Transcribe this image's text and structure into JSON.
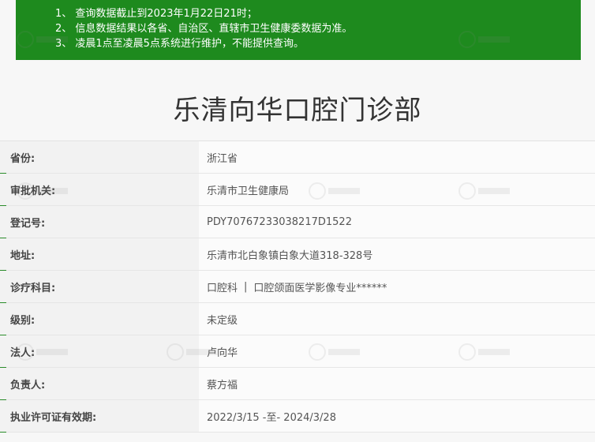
{
  "notice": {
    "lines": [
      "1、 查询数据截止到2023年1月22日21时；",
      "2、 信息数据结果以各省、自治区、直辖市卫生健康委数据为准。",
      "3、 凌晨1点至凌晨5点系统进行维护，不能提供查询。"
    ]
  },
  "title": "乐清向华口腔门诊部",
  "rows": [
    {
      "label": "省份:",
      "value": "浙江省"
    },
    {
      "label": "审批机关:",
      "value": "乐清市卫生健康局"
    },
    {
      "label": "登记号:",
      "value": "PDY70767233038217D1522"
    },
    {
      "label": "地址:",
      "value": "乐清市北白象镇白象大道318-328号"
    },
    {
      "label": "诊疗科目:",
      "value_a": "口腔科",
      "separator": "|",
      "value_b": "口腔颌面医学影像专业******"
    },
    {
      "label": "级别:",
      "value": "未定级"
    },
    {
      "label": "法人:",
      "value": "卢向华"
    },
    {
      "label": "负责人:",
      "value": "蔡方福"
    },
    {
      "label": "执业许可证有效期:",
      "value": "2022/3/15 -至- 2024/3/28"
    }
  ]
}
